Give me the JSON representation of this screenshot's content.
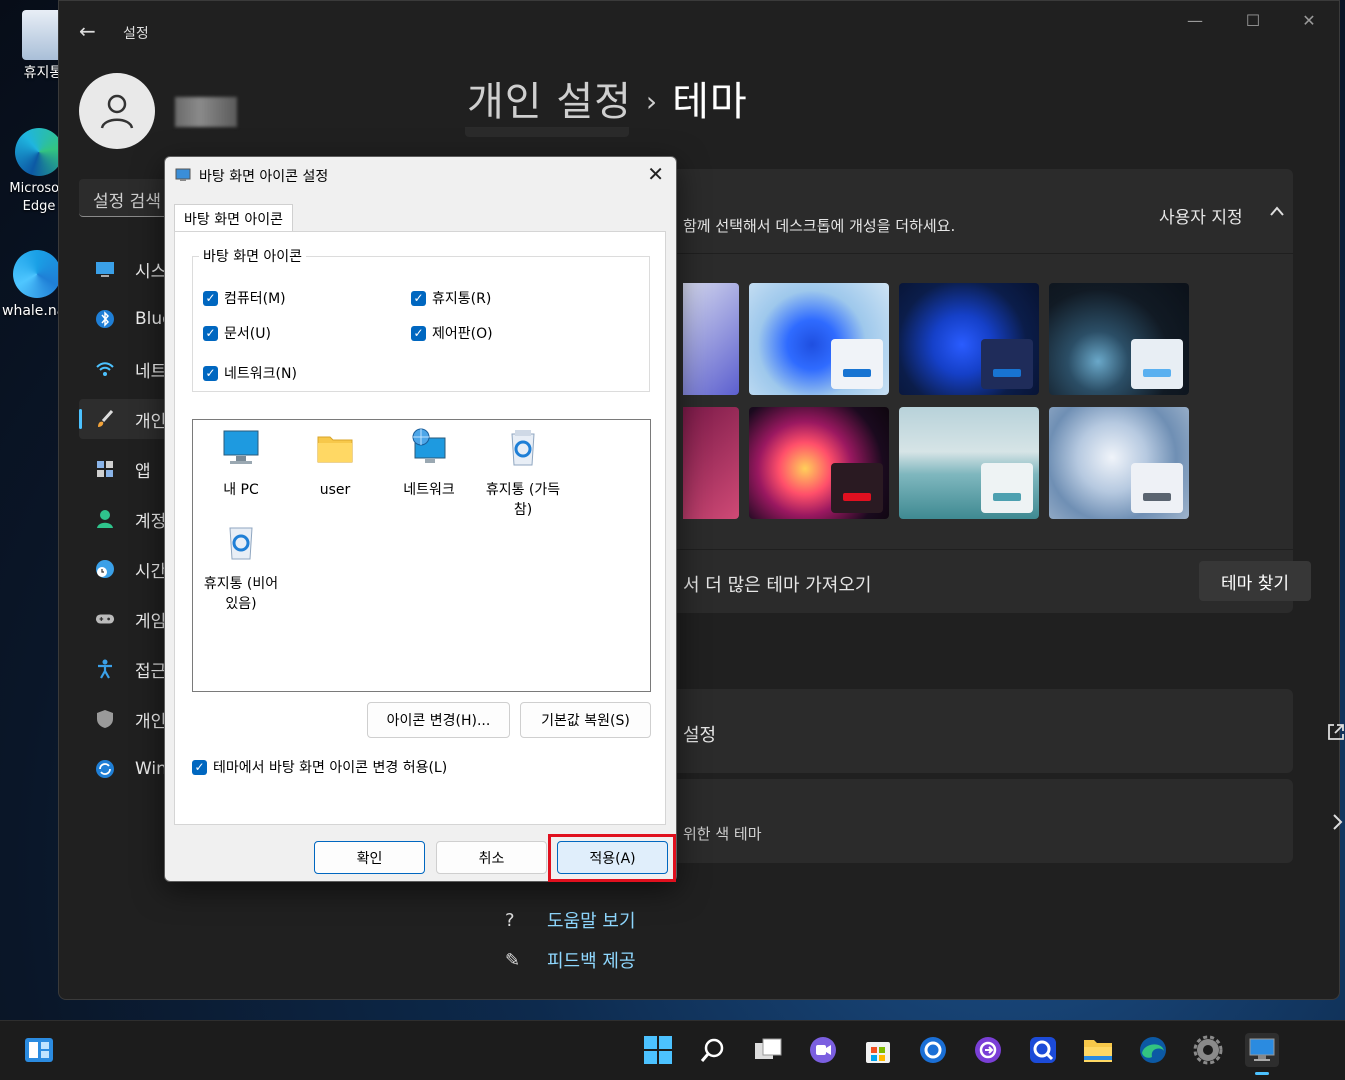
{
  "desktop": {
    "icons": [
      {
        "label": "휴지통"
      },
      {
        "label": "Microsoft Edge"
      },
      {
        "label": "whale.na"
      }
    ]
  },
  "settings": {
    "app_title": "설정",
    "search_placeholder": "설정 검색",
    "nav": [
      {
        "label": "시스템",
        "icon": "monitor-icon"
      },
      {
        "label": "Bluetooth",
        "icon": "bluetooth-icon"
      },
      {
        "label": "네트워크",
        "icon": "wifi-icon"
      },
      {
        "label": "개인 설정",
        "icon": "brush-icon",
        "active": true
      },
      {
        "label": "앱",
        "icon": "apps-icon"
      },
      {
        "label": "계정",
        "icon": "person-icon"
      },
      {
        "label": "시간",
        "icon": "clock-globe-icon"
      },
      {
        "label": "게임",
        "icon": "gamepad-icon"
      },
      {
        "label": "접근성",
        "icon": "accessibility-icon"
      },
      {
        "label": "개인 정보",
        "icon": "shield-icon"
      },
      {
        "label": "Windows Update",
        "icon": "update-icon"
      }
    ],
    "breadcrumb_parent": "개인 설정",
    "breadcrumb_sep": "›",
    "breadcrumb_current": "테마",
    "theme_panel": {
      "description": "함께 선택해서 데스크톱에 개성을 더하세요.",
      "current_theme": "사용자 지정",
      "more_themes_text": "서 더 많은 테마 가져오기",
      "find_themes_button": "테마 찾기"
    },
    "related": {
      "desktop_icon_settings": "설정",
      "contrast_themes": "위한 색 테마"
    },
    "help": {
      "get_help": "도움말 보기",
      "feedback": "피드백 제공"
    }
  },
  "dialog": {
    "title": "바탕 화면 아이콘 설정",
    "tab": "바탕 화면 아이콘",
    "group_title": "바탕 화면 아이콘",
    "checks": {
      "computer": "컴퓨터(M)",
      "recycle": "휴지통(R)",
      "documents": "문서(U)",
      "control_panel": "제어판(O)",
      "network": "네트워크(N)"
    },
    "icons": [
      {
        "label": "내 PC"
      },
      {
        "label": "user"
      },
      {
        "label": "네트워크"
      },
      {
        "label": "휴지통 (가득 참)"
      },
      {
        "label": "휴지통 (비어 있음)"
      }
    ],
    "change_icon_button": "아이콘 변경(H)...",
    "restore_default_button": "기본값 복원(S)",
    "allow_theme_change": "테마에서 바탕 화면 아이콘 변경 허용(L)",
    "ok_button": "확인",
    "cancel_button": "취소",
    "apply_button": "적용(A)"
  },
  "colors": {
    "accent": "#0067c0",
    "highlight": "#e0101e",
    "link": "#8fd8ff"
  }
}
